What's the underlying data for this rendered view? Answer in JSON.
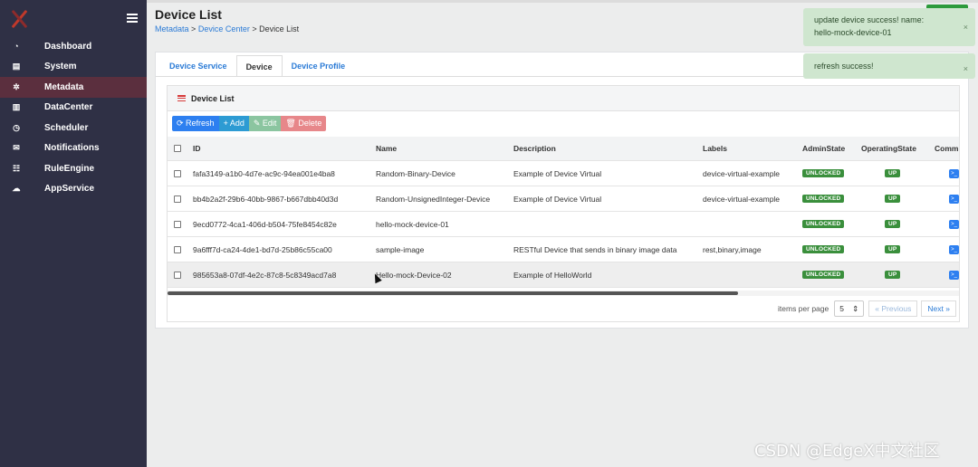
{
  "sidebar": {
    "items": [
      {
        "label": "Dashboard",
        "icon": "dashboard-icon",
        "glyph": "◔",
        "active": false
      },
      {
        "label": "System",
        "icon": "system-icon",
        "glyph": "▤",
        "active": false
      },
      {
        "label": "Metadata",
        "icon": "metadata-icon",
        "glyph": "✲",
        "active": true
      },
      {
        "label": "DataCenter",
        "icon": "database-icon",
        "glyph": "▥",
        "active": false
      },
      {
        "label": "Scheduler",
        "icon": "clock-icon",
        "glyph": "◷",
        "active": false
      },
      {
        "label": "Notifications",
        "icon": "mail-icon",
        "glyph": "✉",
        "active": false
      },
      {
        "label": "RuleEngine",
        "icon": "sliders-icon",
        "glyph": "☷",
        "active": false
      },
      {
        "label": "AppService",
        "icon": "cloud-icon",
        "glyph": "☁",
        "active": false
      }
    ]
  },
  "header": {
    "title": "Device List",
    "breadcrumb": {
      "b1": "Metadata",
      "sep1": ">",
      "b2": "Device Center",
      "sep2": ">",
      "b3": "Device List"
    }
  },
  "tabs": {
    "t1": "Device Service",
    "t2": "Device",
    "t3": "Device Profile"
  },
  "panel": {
    "title": "Device List"
  },
  "toolbar": {
    "refresh": "Refresh",
    "add": "Add",
    "edit": "Edit",
    "delete": "Delete"
  },
  "table": {
    "columns": {
      "id": "ID",
      "name": "Name",
      "description": "Description",
      "labels": "Labels",
      "admin": "AdminState",
      "operating": "OperatingState",
      "command": "Comm"
    },
    "rows": [
      {
        "id": "fafa3149-a1b0-4d7e-ac9c-94ea001e4ba8",
        "name": "Random-Binary-Device",
        "description": "Example of Device Virtual",
        "labels": "device-virtual-example",
        "admin": "UNLOCKED",
        "operating": "UP"
      },
      {
        "id": "bb4b2a2f-29b6-40bb-9867-b667dbb40d3d",
        "name": "Random-UnsignedInteger-Device",
        "description": "Example of Device Virtual",
        "labels": "device-virtual-example",
        "admin": "UNLOCKED",
        "operating": "UP"
      },
      {
        "id": "9ecd0772-4ca1-406d-b504-75fe8454c82e",
        "name": "hello-mock-device-01",
        "description": "",
        "labels": "",
        "admin": "UNLOCKED",
        "operating": "UP"
      },
      {
        "id": "9a6fff7d-ca24-4de1-bd7d-25b86c55ca00",
        "name": "sample-image",
        "description": "RESTful Device that sends in binary image data",
        "labels": "rest,binary,image",
        "admin": "UNLOCKED",
        "operating": "UP"
      },
      {
        "id": "985653a8-07df-4e2c-87c8-5c8349acd7a8",
        "name": "Hello-mock-Device-02",
        "description": "Example of HelloWorld",
        "labels": "",
        "admin": "UNLOCKED",
        "operating": "UP"
      }
    ]
  },
  "pager": {
    "label": "items per page",
    "per_page": "5",
    "prev": "« Previous",
    "next": "Next »"
  },
  "toasts": {
    "t1_line1": "update device success! name:",
    "t1_line2": "hello-mock-device-01",
    "t2": "refresh success!",
    "close": "×"
  },
  "watermark": "CSDN @EdgeX中文社区",
  "colors": {
    "sidebar": "#2f3045",
    "active_item": "#5b2f3e",
    "link": "#2b7bd6",
    "badge_green": "#3a8f3c",
    "toast_bg": "#cfe6cf"
  }
}
